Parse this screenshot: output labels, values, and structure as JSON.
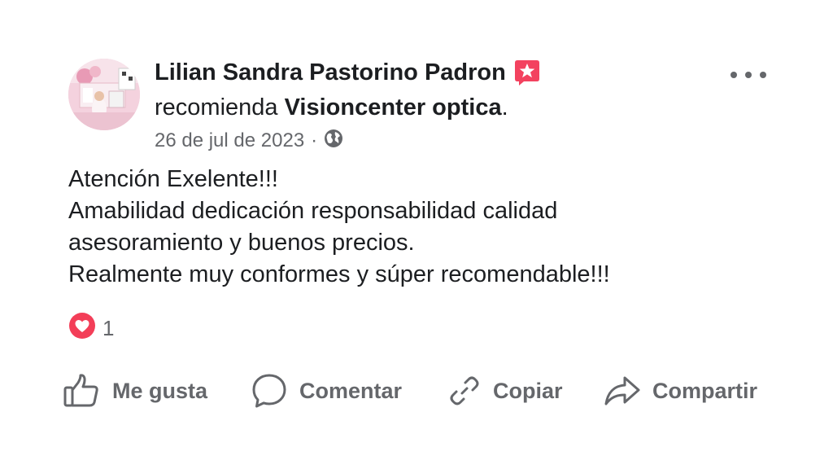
{
  "post": {
    "author": "Lilian Sandra Pastorino Padron",
    "recommends_prefix": "recomienda",
    "page_name": "Visioncenter optica",
    "recommends_suffix": ".",
    "date": "26 de jul de 2023",
    "separator": "·",
    "body_lines": [
      "Atención Exelente!!!",
      "Amabilidad dedicación responsabilidad calidad",
      "asesoramiento y buenos precios.",
      "Realmente muy conformes y súper recomendable!!!"
    ],
    "reaction_count": "1"
  },
  "actions": {
    "like": "Me gusta",
    "comment": "Comentar",
    "copy": "Copiar",
    "share": "Compartir"
  },
  "icons": {
    "badge": "recommendation-star-icon",
    "audience": "globe-icon",
    "reaction": "heart-icon",
    "more": "more-options-icon",
    "like": "thumbs-up-icon",
    "comment": "comment-bubble-icon",
    "copy": "link-icon",
    "share": "share-arrow-icon"
  },
  "colors": {
    "text_primary": "#1c1e21",
    "text_secondary": "#65676b",
    "badge_bg": "#f3425f",
    "heart_bg": "#f33e58"
  }
}
